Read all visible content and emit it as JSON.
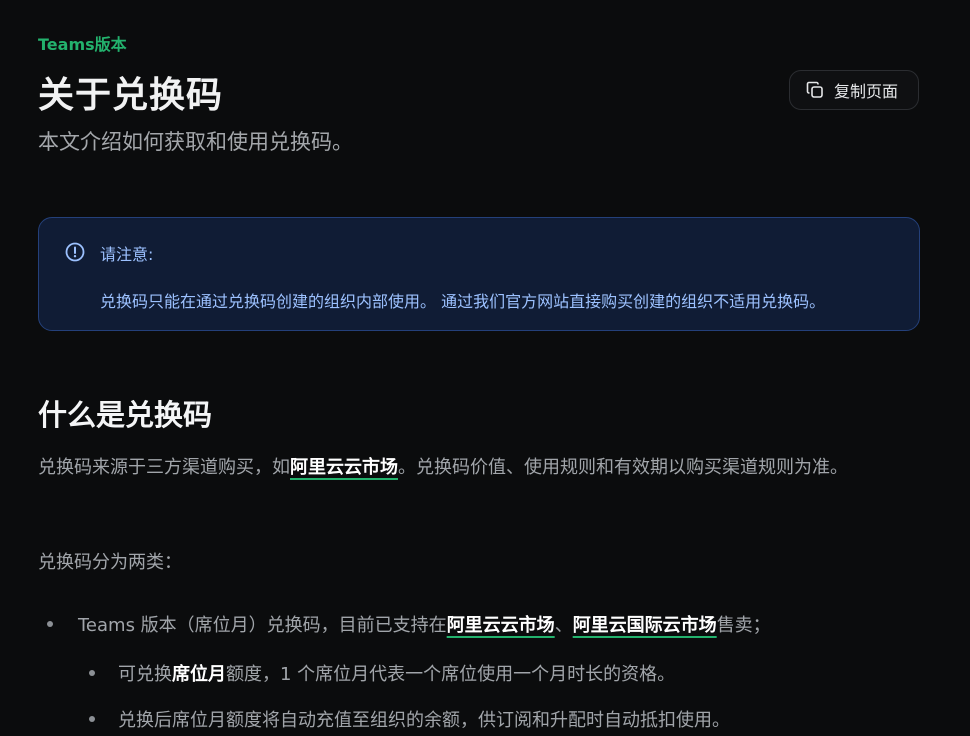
{
  "header": {
    "eyebrow": "Teams版本",
    "title": "关于兑换码",
    "subtitle": "本文介绍如何获取和使用兑换码。",
    "copy_button_label": "复制页面",
    "copy_icon": "copy-icon"
  },
  "note": {
    "icon": "info-icon",
    "title": "请注意:",
    "body": "兑换码只能在通过兑换码创建的组织内部使用。 通过我们官方网站直接购买创建的组织不适用兑换码。"
  },
  "section": {
    "heading": "什么是兑换码",
    "para1_before": "兑换码来源于三方渠道购买，如",
    "para1_link": "阿里云云市场",
    "para1_after": "。兑换码价值、使用规则和有效期以购买渠道规则为准。",
    "para2": "兑换码分为两类：",
    "bullet1_before": "Teams 版本（席位月）兑换码，目前已支持在",
    "bullet1_link1": "阿里云云市场",
    "bullet1_sep": "、",
    "bullet1_link2": "阿里云国际云市场",
    "bullet1_after": "售卖；",
    "sub1_before": "可兑换",
    "sub1_strong": "席位月",
    "sub1_after": "额度，1 个席位月代表一个席位使用一个月时长的资格。",
    "sub2": "兑换后席位月额度将自动充值至组织的余额，供订阅和升配时自动抵扣使用。"
  },
  "colors": {
    "accent": "#23b26d",
    "background": "#0b0c0d",
    "note_bg": "#101c35",
    "note_border": "#24407a",
    "note_text": "#9cc1ff"
  }
}
